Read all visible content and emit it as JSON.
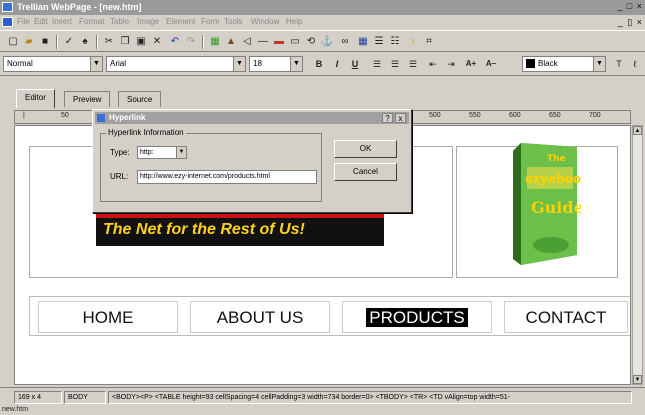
{
  "window": {
    "title": "Trellian WebPage - [new.htm]",
    "controls": "_ □ ×",
    "doc_controls": "_ ▯ ×"
  },
  "menu": {
    "items": [
      "File",
      "Edit",
      "Insert",
      "Format",
      "Table",
      "Image",
      "Element",
      "Form",
      "Tools",
      "Window",
      "Help"
    ]
  },
  "format_bar": {
    "style": "Normal",
    "font": "Arial",
    "size": "18",
    "bold": "B",
    "italic": "I",
    "underline": "U",
    "grow": "A+",
    "shrink": "A–",
    "color_label": "Black"
  },
  "tabs": [
    "Editor",
    "Preview",
    "Source"
  ],
  "ruler": [
    "50",
    "500",
    "550",
    "600",
    "650",
    "700"
  ],
  "page": {
    "banner_text": "The Net for the Rest of Us!",
    "book_title_1": "The",
    "book_title_2": "ezyebook",
    "book_title_3": "Guide",
    "nav": [
      "HOME",
      "ABOUT US",
      "PRODUCTS",
      "CONTACT"
    ]
  },
  "dialog": {
    "title": "Hyperlink",
    "help": "?",
    "close": "x",
    "group_label": "Hyperlink Information",
    "type_label": "Type:",
    "type_value": "http:",
    "url_label": "URL:",
    "url_value": "http://www.ezy-internet.com/products.html",
    "ok": "OK",
    "cancel": "Cancel"
  },
  "status": {
    "dimensions": "169 x 4",
    "element": "BODY",
    "path": "<BODY><P> <TABLE height=93 cellSpacing=4 cellPadding=3 width=734 border=0> <TBODY> <TR> <TD vAlign=top width=51-"
  },
  "filename": "new.htm",
  "colors": {
    "accent": "#3a6fd6",
    "banner_bg": "#111111",
    "banner_text": "#ffd21a",
    "nav_selected_bg": "#000000"
  }
}
